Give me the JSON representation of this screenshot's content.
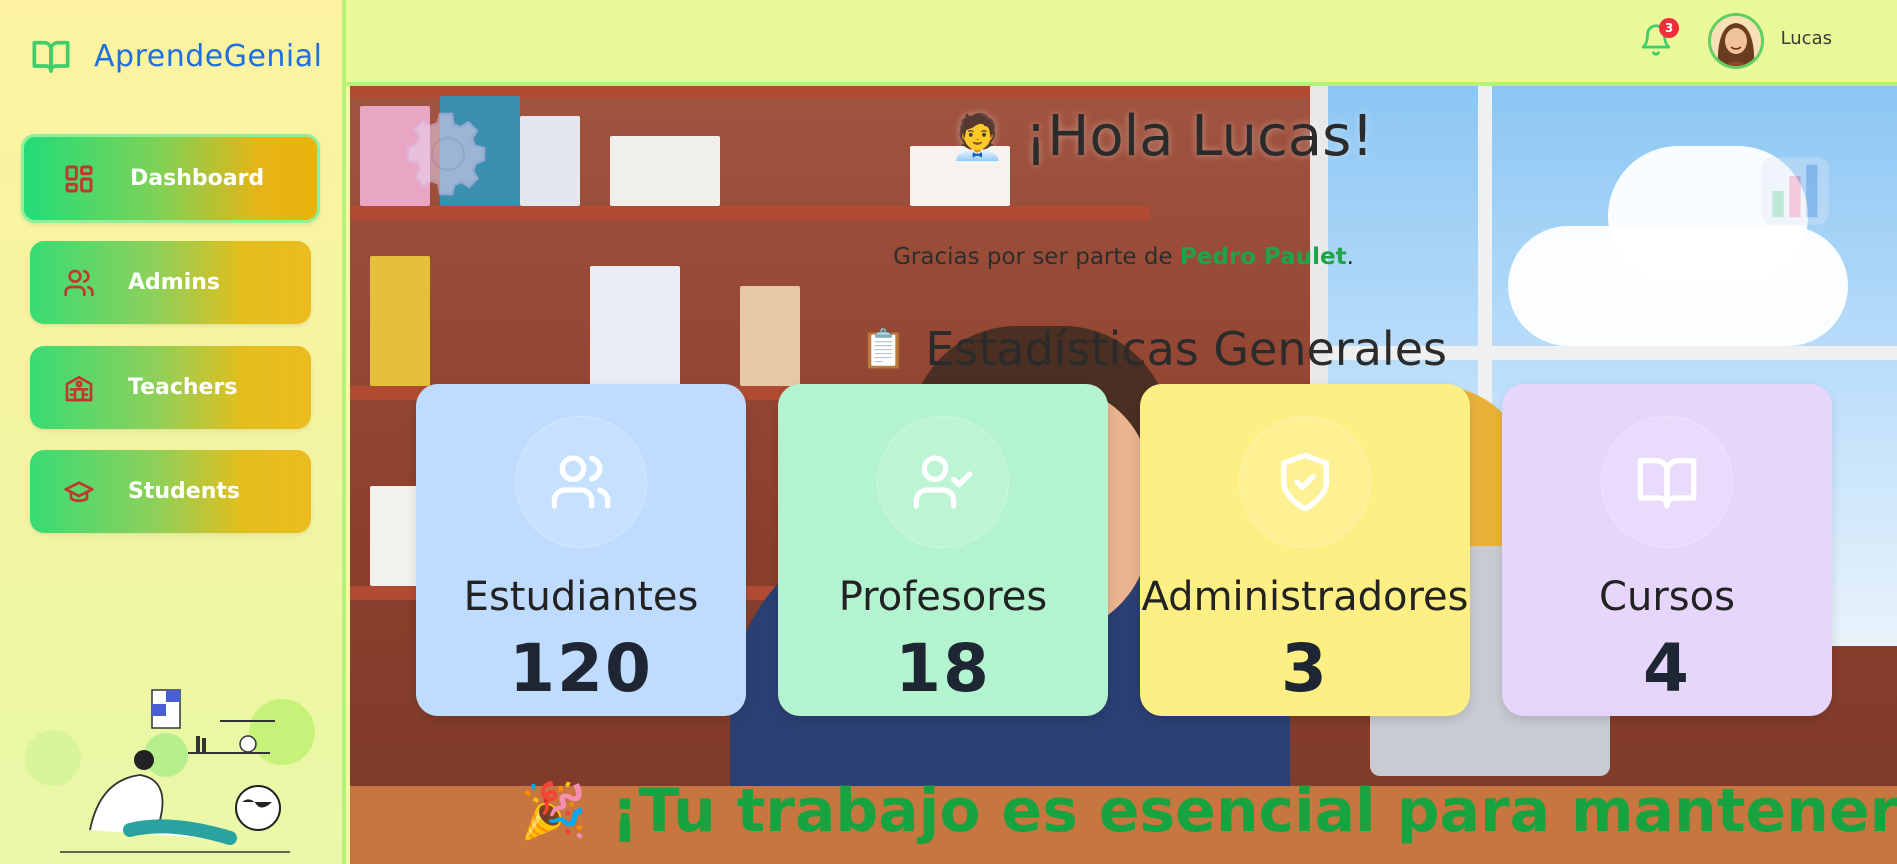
{
  "brand": {
    "name": "AprendeGenial",
    "icon": "open-book-icon"
  },
  "sidebar": {
    "items": [
      {
        "label": "Dashboard",
        "icon": "dashboard-grid-icon",
        "active": true
      },
      {
        "label": "Admins",
        "icon": "users-icon",
        "active": false
      },
      {
        "label": "Teachers",
        "icon": "school-building-icon",
        "active": false
      },
      {
        "label": "Students",
        "icon": "graduation-cap-icon",
        "active": false
      }
    ]
  },
  "topbar": {
    "notifications_count": "3",
    "username": "Lucas"
  },
  "main": {
    "greeting": "¡Hola Lucas!",
    "greeting_emoji": "🧑‍💼",
    "thanks_prefix": "Gracias por ser parte de ",
    "thanks_highlight": "Pedro Paulet",
    "thanks_suffix": ".",
    "section_title": "Estadísticas Generales",
    "section_emoji": "📋",
    "stats": [
      {
        "label": "Estudiantes",
        "value": "120",
        "icon": "users-icon",
        "color": "#bfdcff"
      },
      {
        "label": "Profesores",
        "value": "18",
        "icon": "user-check-icon",
        "color": "#b4f3cf"
      },
      {
        "label": "Administradores",
        "value": "3",
        "icon": "shield-check-icon",
        "color": "#fdef84"
      },
      {
        "label": "Cursos",
        "value": "4",
        "icon": "open-book-icon",
        "color": "#e6d6fc"
      }
    ],
    "motto": "¡Tu trabajo es esencial para mantener",
    "motto_emoji": "🎉"
  },
  "colors": {
    "brand_blue": "#1f6fe0",
    "accent_green": "#17a33f",
    "border_green": "#b6f17a",
    "badge_red": "#ef2e3c"
  }
}
